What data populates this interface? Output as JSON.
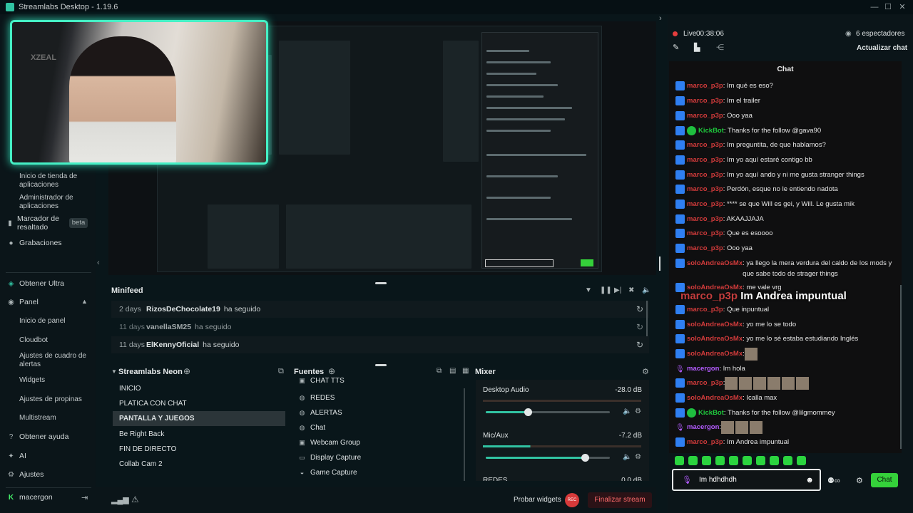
{
  "window": {
    "title": "Streamlabs Desktop - 1.19.6",
    "minimize": "—",
    "maximize": "☐",
    "close": "✕"
  },
  "sidebar": {
    "items": [
      {
        "label": "Inicio de tienda de aplicaciones"
      },
      {
        "label": "Administrador de aplicaciones"
      },
      {
        "label": "Marcador de resaltado",
        "badge": "beta"
      },
      {
        "label": "Grabaciones"
      },
      {
        "label": "Obtener Ultra"
      },
      {
        "label": "Panel"
      },
      {
        "label": "Inicio de panel"
      },
      {
        "label": "Cloudbot"
      },
      {
        "label": "Ajustes de cuadro de alertas"
      },
      {
        "label": "Widgets"
      },
      {
        "label": "Ajustes de propinas"
      },
      {
        "label": "Multistream"
      },
      {
        "label": "Obtener ayuda"
      },
      {
        "label": "AI"
      },
      {
        "label": "Ajustes"
      },
      {
        "label": "macergon"
      }
    ]
  },
  "webcam": {
    "watermark": "XZEAL"
  },
  "preview": {
    "overlay_text": "Im Andrea impuntual"
  },
  "minifeed": {
    "title": "Minifeed",
    "rows": [
      {
        "days": "2 days",
        "user": "RizosDeChocolate19",
        "action": "ha seguido"
      },
      {
        "days": "11 days",
        "user": "vanellaSM25",
        "action": "ha seguido"
      },
      {
        "days": "11 days",
        "user": "ElKennyOficial",
        "action": "ha seguido"
      }
    ]
  },
  "scenes": {
    "title": "Streamlabs Neon",
    "items": [
      "INICIO",
      "PLATICA CON CHAT",
      "PANTALLA Y JUEGOS",
      "Be Right Back",
      "FIN DE DIRECTO",
      "Collab Cam 2"
    ],
    "selected_index": 2
  },
  "sources": {
    "title": "Fuentes",
    "items": [
      {
        "label": "CHAT TTS",
        "icon": "folder-icon"
      },
      {
        "label": "REDES",
        "icon": "globe-icon"
      },
      {
        "label": "ALERTAS",
        "icon": "globe-icon"
      },
      {
        "label": "Chat",
        "icon": "globe-icon"
      },
      {
        "label": "Webcam Group",
        "icon": "folder-icon"
      },
      {
        "label": "Display Capture",
        "icon": "monitor-icon"
      },
      {
        "label": "Game Capture",
        "icon": "gamepad-icon"
      }
    ]
  },
  "mixer": {
    "title": "Mixer",
    "channels": [
      {
        "name": "Desktop Audio",
        "db": "-28.0 dB",
        "level": 0.34
      },
      {
        "name": "Mic/Aux",
        "db": "-7.2 dB",
        "level": 0.8
      },
      {
        "name": "REDES",
        "db": "0.0 dB",
        "level": 1.0
      }
    ]
  },
  "bottombar": {
    "test_widgets": "Probar widgets",
    "rec_label": "REC",
    "end_stream": "Finalizar stream"
  },
  "live": {
    "status": "Live",
    "time": "00:38:06",
    "viewers": "6 espectadores",
    "refresh_chat": "Actualizar chat"
  },
  "chat": {
    "title": "Chat",
    "messages": [
      {
        "user": "marco_p3p",
        "text": ": Im qué es eso?"
      },
      {
        "user": "marco_p3p",
        "text": ": Im el trailer"
      },
      {
        "user": "marco_p3p",
        "text": ": Ooo yaa"
      },
      {
        "user": "KickBot",
        "text": ": Thanks for the follow @gava90"
      },
      {
        "user": "marco_p3p",
        "text": ": Im preguntita, de que hablamos?"
      },
      {
        "user": "marco_p3p",
        "text": ": Im yo aquí estaré contigo bb"
      },
      {
        "user": "marco_p3p",
        "text": ": Im yo aquí ando y ni me gusta stranger things"
      },
      {
        "user": "marco_p3p",
        "text": ": Perdón, esque no le entiendo nadota"
      },
      {
        "user": "marco_p3p",
        "text": ": **** se que Will es gei, y Will. Le gusta mik"
      },
      {
        "user": "marco_p3p",
        "text": ": AKAAJJAJA"
      },
      {
        "user": "marco_p3p",
        "text": ": Que es esoooo"
      },
      {
        "user": "marco_p3p",
        "text": ": Ooo yaa"
      },
      {
        "user": "soloAndreaOsMx",
        "text": ": ya llego la mera verdura del caldo de los mods y que sabe todo de strager things"
      },
      {
        "user": "soloAndreaOsMx",
        "text": ": me vale vrg"
      },
      {
        "user": "marco_p3p",
        "text": ": Que inpuntual"
      },
      {
        "user": "soloAndreaOsMx",
        "text": ": yo me lo se todo"
      },
      {
        "user": "soloAndreaOsMx",
        "text": ": yo me lo sé estaba estudiando Inglés"
      },
      {
        "user": "soloAndreaOsMx",
        "text": ":"
      },
      {
        "user": "macergon",
        "text": ": Im hola"
      },
      {
        "user": "marco_p3p",
        "text": ":"
      },
      {
        "user": "soloAndreaOsMx",
        "text": ": Icalla max"
      },
      {
        "user": "KickBot",
        "text": ": Thanks for the follow @lilgmommey"
      },
      {
        "user": "macergon",
        "text": ":"
      },
      {
        "user": "marco_p3p",
        "text": ": Im Andrea impuntual"
      }
    ],
    "input_value": "Im hdhdhdh",
    "send_label": "Chat"
  }
}
